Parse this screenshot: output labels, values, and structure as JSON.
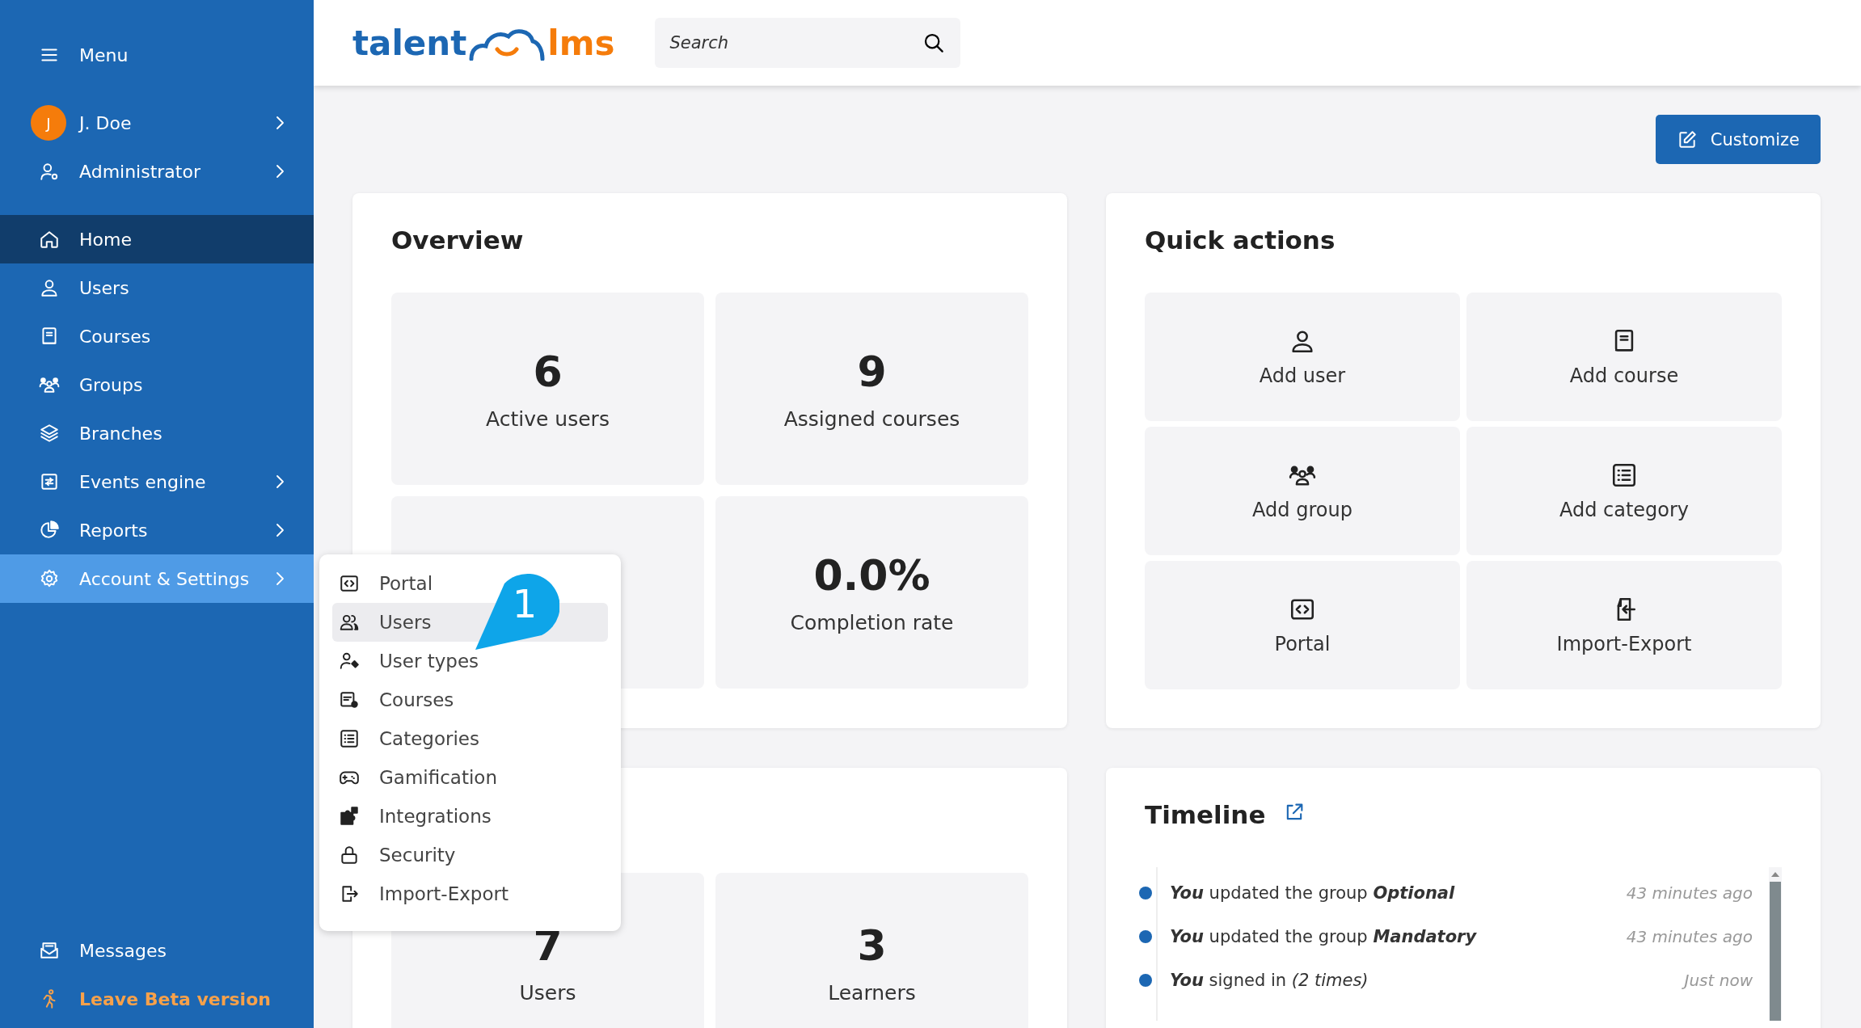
{
  "sidebar": {
    "menu_label": "Menu",
    "profile": [
      {
        "label": "J. Doe",
        "avatar": "J",
        "has_submenu": true
      },
      {
        "label": "Administrator",
        "has_submenu": true
      }
    ],
    "items": [
      {
        "label": "Home",
        "selected": true,
        "expanded": false,
        "has_submenu": false
      },
      {
        "label": "Users",
        "selected": false,
        "expanded": false,
        "has_submenu": false
      },
      {
        "label": "Courses",
        "selected": false,
        "expanded": false,
        "has_submenu": false
      },
      {
        "label": "Groups",
        "selected": false,
        "expanded": false,
        "has_submenu": false
      },
      {
        "label": "Branches",
        "selected": false,
        "expanded": false,
        "has_submenu": false
      },
      {
        "label": "Events engine",
        "selected": false,
        "expanded": false,
        "has_submenu": true
      },
      {
        "label": "Reports",
        "selected": false,
        "expanded": false,
        "has_submenu": true
      },
      {
        "label": "Account & Settings",
        "selected": false,
        "expanded": true,
        "has_submenu": true
      }
    ],
    "footer": [
      {
        "label": "Messages",
        "kind": "normal"
      },
      {
        "label": "Leave Beta version",
        "kind": "accent"
      }
    ]
  },
  "header": {
    "logo": {
      "left": "talent",
      "right": "lms"
    },
    "search": {
      "placeholder": "Search"
    }
  },
  "toolbar": {
    "customize_button": "Customize"
  },
  "overview": {
    "title": "Overview",
    "tiles": [
      {
        "value": "6",
        "label": "Active users",
        "covered": false
      },
      {
        "value": "9",
        "label": "Assigned courses",
        "covered": false
      },
      {
        "covered": true
      },
      {
        "value": "0.0%",
        "label": "Completion rate",
        "covered": false
      }
    ]
  },
  "quick_actions": {
    "title": "Quick actions",
    "items": [
      {
        "label": "Add user"
      },
      {
        "label": "Add course"
      },
      {
        "label": "Add group"
      },
      {
        "label": "Add category"
      },
      {
        "label": "Portal"
      },
      {
        "label": "Import-Export"
      }
    ]
  },
  "card_2": {
    "tiles": [
      {
        "value": "7",
        "label": "Users"
      },
      {
        "value": "3",
        "label": "Learners"
      }
    ]
  },
  "timeline": {
    "title": "Timeline",
    "entries": [
      {
        "text": "**You** updated the group **Optional**",
        "time": "43 minutes ago"
      },
      {
        "text": "**You** updated the group **Mandatory**",
        "time": "43 minutes ago"
      },
      {
        "text": "**You** signed in *(2 times)*",
        "time": "Just now"
      }
    ]
  },
  "flyout": {
    "items": [
      {
        "label": "Portal",
        "highlighted": false
      },
      {
        "label": "Users",
        "highlighted": true
      },
      {
        "label": "User types",
        "highlighted": false
      },
      {
        "label": "Courses",
        "highlighted": false
      },
      {
        "label": "Categories",
        "highlighted": false
      },
      {
        "label": "Gamification",
        "highlighted": false
      },
      {
        "label": "Integrations",
        "highlighted": false
      },
      {
        "label": "Security",
        "highlighted": false
      },
      {
        "label": "Import-Export",
        "highlighted": false
      }
    ]
  },
  "callout": {
    "number": "1"
  }
}
